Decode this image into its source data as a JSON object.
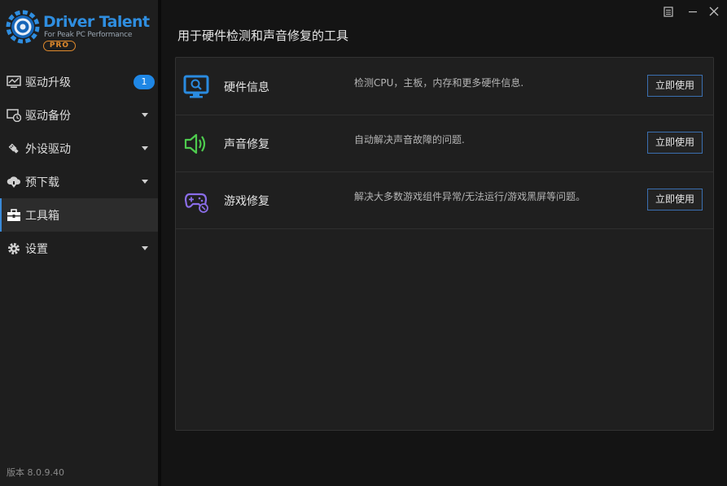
{
  "app": {
    "brand_name": "Driver Talent",
    "tagline": "For Peak PC Performance",
    "edition": "PRO",
    "version": "版本 8.0.9.40"
  },
  "colors": {
    "accent": "#1f87e5",
    "brand": "#2f8ee0",
    "pro_orange": "#e08a2c",
    "button_border": "#3b6fb0",
    "sound_icon": "#4ecb4e",
    "game_icon": "#8a6de8"
  },
  "sidebar": {
    "items": [
      {
        "label": "驱动升级",
        "icon": "monitor-update-icon",
        "badge": "1",
        "active": false
      },
      {
        "label": "驱动备份",
        "icon": "backup-clock-icon",
        "has_arrow": true,
        "active": false
      },
      {
        "label": "外设驱动",
        "icon": "usb-plug-icon",
        "has_arrow": true,
        "active": false
      },
      {
        "label": "预下载",
        "icon": "cloud-download-icon",
        "has_arrow": true,
        "active": false
      },
      {
        "label": "工具箱",
        "icon": "toolbox-icon",
        "active": true
      },
      {
        "label": "设置",
        "icon": "gear-icon",
        "has_arrow": true,
        "active": false
      }
    ]
  },
  "window_controls": [
    "menu-icon",
    "minimize-icon",
    "close-icon"
  ],
  "main": {
    "title": "用于硬件检测和声音修复的工具",
    "tools": [
      {
        "name": "硬件信息",
        "icon": "hardware-monitor-icon",
        "description": "检测CPU，主板，内存和更多硬件信息.",
        "button": "立即使用"
      },
      {
        "name": "声音修复",
        "icon": "speaker-icon",
        "description": "自动解决声音故障的问题.",
        "button": "立即使用"
      },
      {
        "name": "游戏修复",
        "icon": "gamepad-icon",
        "description": "解决大多数游戏组件异常/无法运行/游戏黑屏等问题。",
        "button": "立即使用"
      }
    ]
  }
}
